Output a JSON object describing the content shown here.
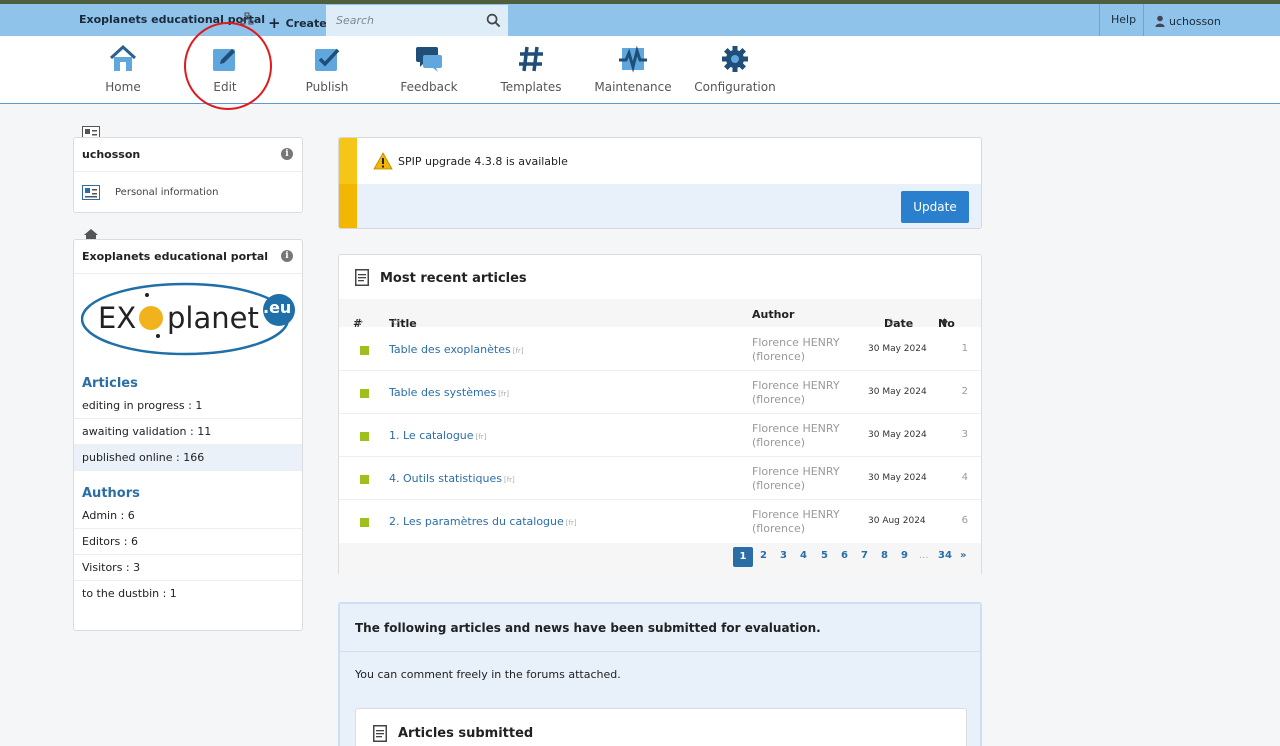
{
  "topbar": {
    "site_name": "Exoplanets educational portal",
    "create_label": "Create",
    "search_placeholder": "Search",
    "help_label": "Help",
    "username": "uchosson"
  },
  "nav": {
    "home": "Home",
    "edit": "Edit",
    "publish": "Publish",
    "feedback": "Feedback",
    "templates": "Templates",
    "maintenance": "Maintenance",
    "configuration": "Configuration"
  },
  "sidebar": {
    "user_box": {
      "name": "uchosson",
      "personal_info": "Personal information"
    },
    "site_box": {
      "name": "Exoplanets educational portal",
      "logo_text_left": "EX",
      "logo_text_right": "planet",
      "logo_badge": ".eu",
      "articles_head": "Articles",
      "articles": [
        "editing in progress : 1",
        "awaiting validation : 11",
        "published online : 166"
      ],
      "authors_head": "Authors",
      "authors": [
        "Admin : 6",
        "Editors : 6",
        "Visitors : 3",
        "to the dustbin : 1"
      ]
    }
  },
  "alert": {
    "message": "SPIP upgrade 4.3.8 is available",
    "update_label": "Update"
  },
  "recent": {
    "title": "Most recent articles",
    "columns": {
      "num": "#",
      "title": "Title",
      "author": "Author",
      "date": "Date",
      "no": "No"
    },
    "rows": [
      {
        "title": "Table des exoplanètes",
        "lang": "[fr]",
        "author1": "Florence HENRY",
        "author2": "(florence)",
        "date": "30 May 2024",
        "no": "1"
      },
      {
        "title": "Table des systèmes",
        "lang": "[fr]",
        "author1": "Florence HENRY",
        "author2": "(florence)",
        "date": "30 May 2024",
        "no": "2"
      },
      {
        "title": "1. Le catalogue",
        "lang": "[fr]",
        "author1": "Florence HENRY",
        "author2": "(florence)",
        "date": "30 May 2024",
        "no": "3"
      },
      {
        "title": "4. Outils statistiques",
        "lang": "[fr]",
        "author1": "Florence HENRY",
        "author2": "(florence)",
        "date": "30 May 2024",
        "no": "4"
      },
      {
        "title": "2. Les paramètres du catalogue",
        "lang": "[fr]",
        "author1": "Florence HENRY",
        "author2": "(florence)",
        "date": "30 Aug 2024",
        "no": "6"
      }
    ],
    "pager": {
      "current": "1",
      "pages": [
        "2",
        "3",
        "4",
        "5",
        "6",
        "7",
        "8",
        "9"
      ],
      "ellipsis": "...",
      "last": "34",
      "next": "»"
    }
  },
  "submitted": {
    "heading": "The following articles and news have been submitted for evaluation.",
    "description": "You can comment freely in the forums attached.",
    "inner_title": "Articles submitted"
  }
}
